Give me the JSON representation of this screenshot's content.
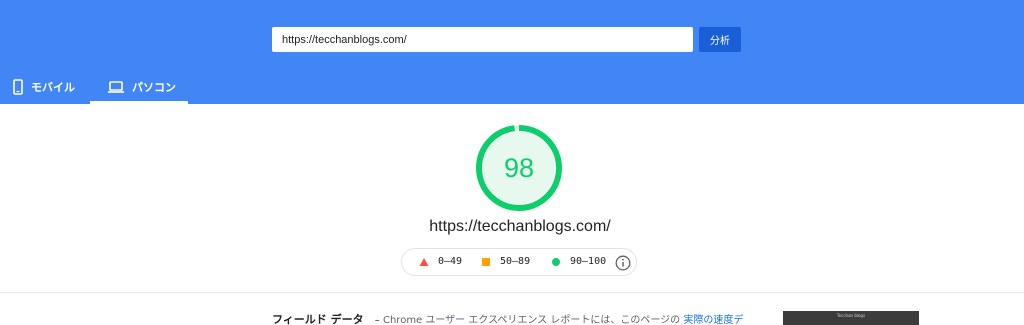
{
  "header": {
    "url_value": "https://tecchanblogs.com/",
    "analyze_label": "分析",
    "tabs": [
      {
        "label": "モバイル",
        "icon": "smartphone-icon",
        "active": false
      },
      {
        "label": "パソコン",
        "icon": "laptop-icon",
        "active": true
      }
    ]
  },
  "report": {
    "score": "98",
    "score_fraction": 0.98,
    "score_color": "#0cce6b",
    "url": "https://tecchanblogs.com/",
    "legend": {
      "fail": "0–49",
      "average": "50–89",
      "pass": "90–100",
      "fail_color": "#ff4e42",
      "average_color": "#ffa400",
      "pass_color": "#0cce6b",
      "info_icon": "info-icon"
    }
  },
  "field_data": {
    "title": "フィールド データ",
    "dash": "–",
    "text": " Chrome ユーザー エクスペリエンス レポートには、このページの",
    "link": "実際の速度デ"
  },
  "thumbnail": {
    "caption": "Tecchan blogs"
  },
  "colors": {
    "header_bg": "#4285f4",
    "button_bg": "#1a5fd6"
  }
}
